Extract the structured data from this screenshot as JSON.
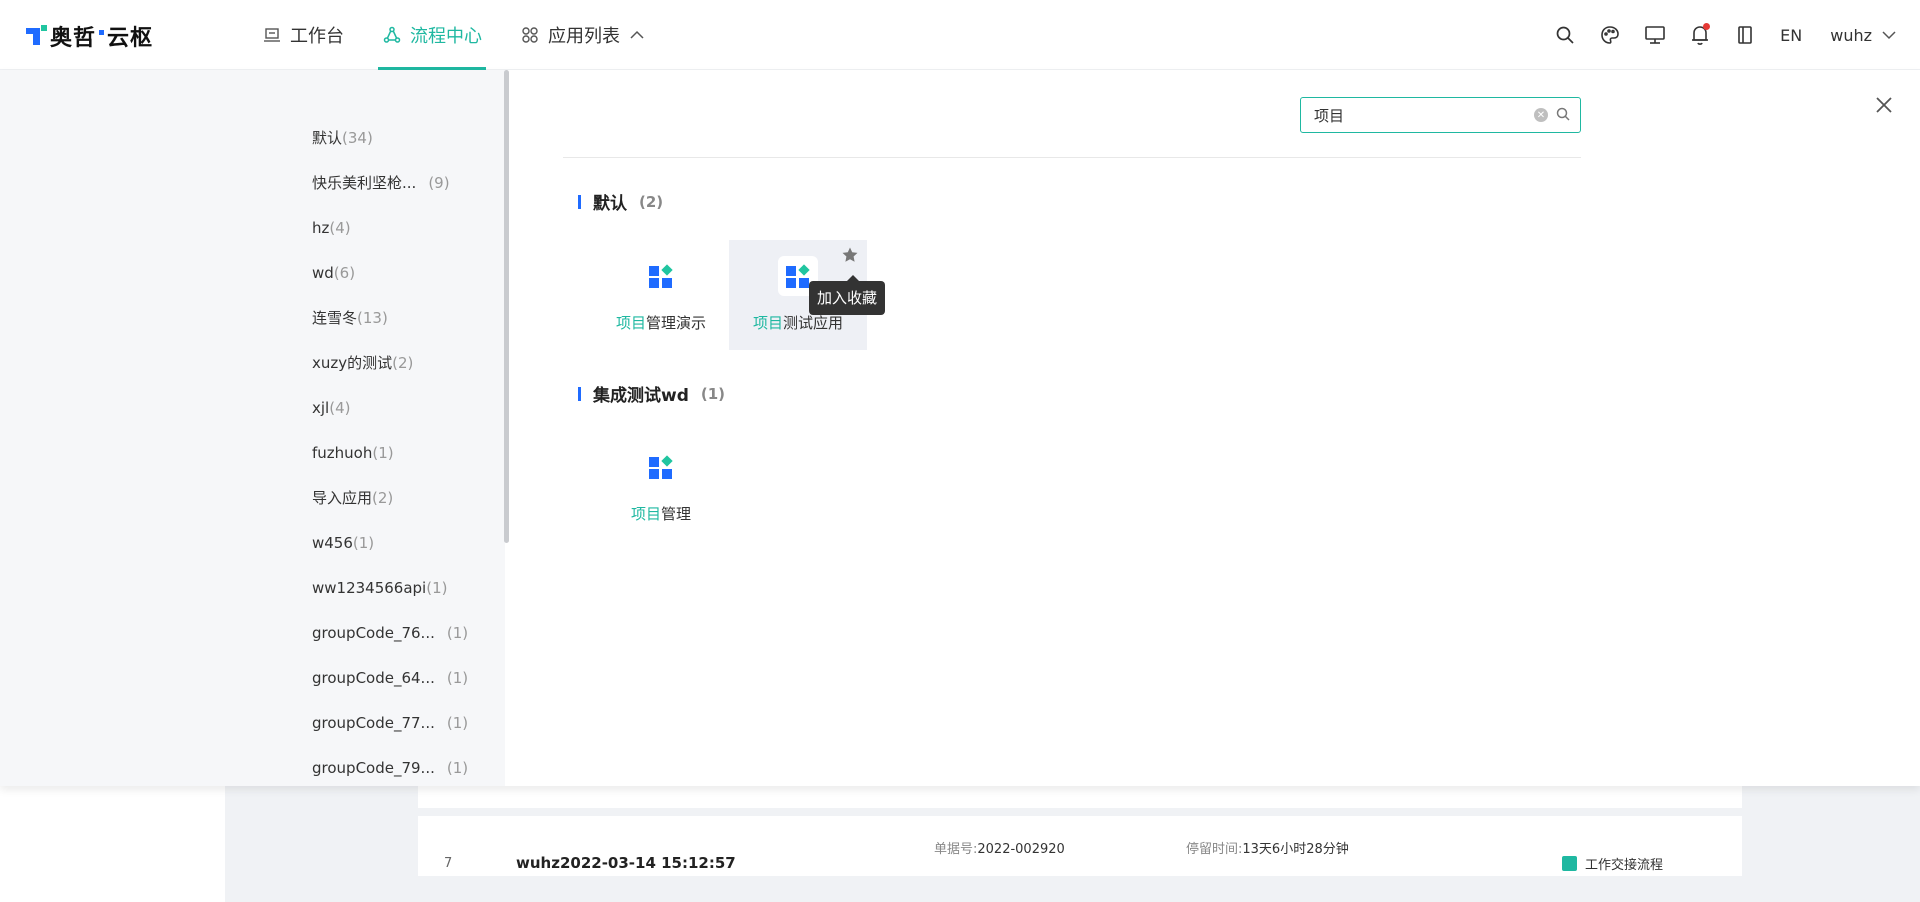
{
  "logo": {
    "part1": "奥哲",
    "part2": "云枢"
  },
  "nav": {
    "workbench": "工作台",
    "flow_center": "流程中心",
    "app_list": "应用列表"
  },
  "header": {
    "lang": "EN",
    "user": "wuhz"
  },
  "categories": [
    {
      "name": "默认",
      "count": "(34)"
    },
    {
      "name": "快乐美利坚枪...",
      "count": "(9)"
    },
    {
      "name": "hz",
      "count": "(4)"
    },
    {
      "name": "wd",
      "count": "(6)"
    },
    {
      "name": "连雪冬",
      "count": "(13)"
    },
    {
      "name": "xuzy的测试",
      "count": "(2)"
    },
    {
      "name": "xjl",
      "count": "(4)"
    },
    {
      "name": "fuzhuoh",
      "count": "(1)"
    },
    {
      "name": "导入应用",
      "count": "(2)"
    },
    {
      "name": "w456",
      "count": "(1)"
    },
    {
      "name": "ww1234566api",
      "count": "(1)"
    },
    {
      "name": "groupCode_76...",
      "count": "(1)"
    },
    {
      "name": "groupCode_64...",
      "count": "(1)"
    },
    {
      "name": "groupCode_77...",
      "count": "(1)"
    },
    {
      "name": "groupCode_79...",
      "count": "(1)"
    }
  ],
  "search": {
    "value": "项目",
    "placeholder": ""
  },
  "groups": [
    {
      "title": "默认",
      "count": "(2)"
    },
    {
      "title": "集成测试wd",
      "count": "(1)"
    }
  ],
  "apps": [
    {
      "highlight": "项目",
      "rest": "管理演示"
    },
    {
      "highlight": "项目",
      "rest": "测试应用"
    },
    {
      "highlight": "项目",
      "rest": "管理"
    }
  ],
  "tooltip": "加入收藏",
  "background_row": {
    "index": "7",
    "title": "wuhz2022-03-14 15:12:57",
    "doc_no_label": "单据号:",
    "doc_no": "2022-002920",
    "stay_label": "停留时间:",
    "stay": "13天6小时28分钟",
    "flow_name": "工作交接流程"
  },
  "colors": {
    "accent": "#1fb8a1",
    "brand_blue": "#1f6bff",
    "badge_red": "#e53935"
  }
}
